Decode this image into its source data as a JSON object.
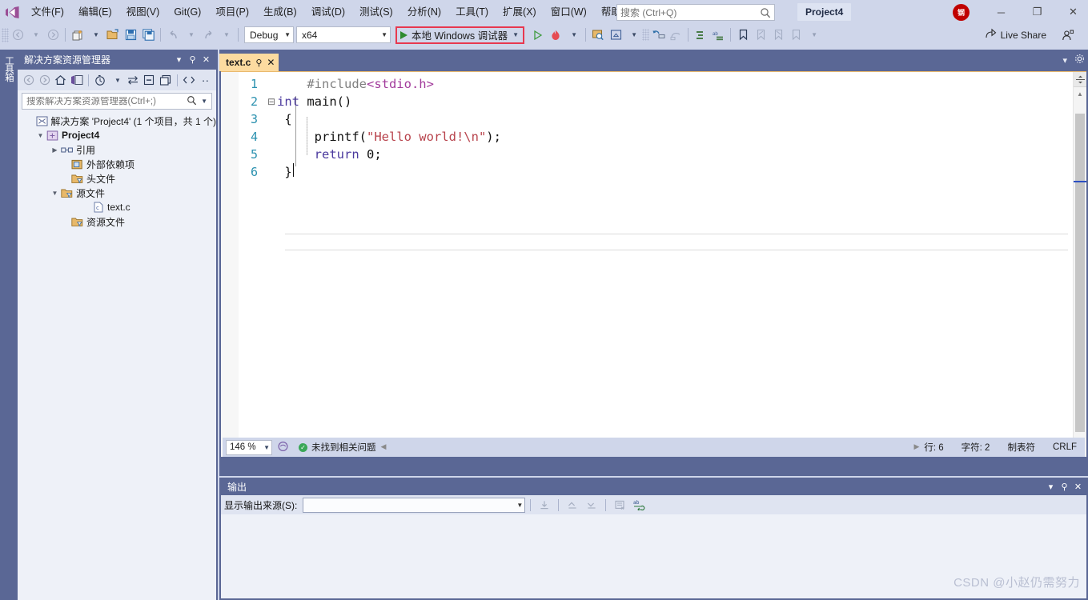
{
  "app": {
    "product": "Visual Studio",
    "project_chip": "Project4",
    "avatar_initial": "钢"
  },
  "menu": {
    "items": [
      {
        "label": "文件(F)",
        "name": "menu-file"
      },
      {
        "label": "编辑(E)",
        "name": "menu-edit"
      },
      {
        "label": "视图(V)",
        "name": "menu-view"
      },
      {
        "label": "Git(G)",
        "name": "menu-git"
      },
      {
        "label": "项目(P)",
        "name": "menu-project"
      },
      {
        "label": "生成(B)",
        "name": "menu-build"
      },
      {
        "label": "调试(D)",
        "name": "menu-debug"
      },
      {
        "label": "测试(S)",
        "name": "menu-test"
      },
      {
        "label": "分析(N)",
        "name": "menu-analyze"
      },
      {
        "label": "工具(T)",
        "name": "menu-tools"
      },
      {
        "label": "扩展(X)",
        "name": "menu-extensions"
      },
      {
        "label": "窗口(W)",
        "name": "menu-window"
      },
      {
        "label": "帮助(H)",
        "name": "menu-help"
      }
    ]
  },
  "search": {
    "placeholder": "搜索 (Ctrl+Q)",
    "value": ""
  },
  "window_controls": {
    "minimize": "─",
    "restore": "❐",
    "close": "✕"
  },
  "toolbar": {
    "configuration": "Debug",
    "platform": "x64",
    "run_label": "本地 Windows 调试器",
    "live_share": "Live Share"
  },
  "toolbox_tab": {
    "label": "工具箱"
  },
  "solution_explorer": {
    "title": "解决方案资源管理器",
    "search_placeholder": "搜索解决方案资源管理器(Ctrl+;)",
    "tree": [
      {
        "label": "解决方案 'Project4' (1 个项目，共 1 个)",
        "icon": "solution-icon",
        "indent": 0,
        "expander": "",
        "bold": false
      },
      {
        "label": "Project4",
        "icon": "project-icon",
        "indent": 1,
        "expander": "▼",
        "bold": true
      },
      {
        "label": "引用",
        "icon": "references-icon",
        "indent": 2,
        "expander": "▶",
        "bold": false
      },
      {
        "label": "外部依赖项",
        "icon": "external-deps-icon",
        "indent": 2,
        "expander": "",
        "bold": false
      },
      {
        "label": "头文件",
        "icon": "filter-folder-icon",
        "indent": 2,
        "expander": "",
        "bold": false
      },
      {
        "label": "源文件",
        "icon": "filter-folder-icon",
        "indent": 2,
        "expander": "▼",
        "bold": false
      },
      {
        "label": "text.c",
        "icon": "c-file-icon",
        "indent": 3,
        "expander": "",
        "bold": false
      },
      {
        "label": "资源文件",
        "icon": "filter-folder-icon",
        "indent": 2,
        "expander": "",
        "bold": false
      }
    ]
  },
  "editor": {
    "tab_label": "text.c",
    "lines": [
      {
        "num": "1",
        "fold": "",
        "tokens": [
          {
            "t": "    ",
            "c": "ctext"
          },
          {
            "t": "#include",
            "c": "pp"
          },
          {
            "t": "<stdio.h>",
            "c": "hdr"
          }
        ]
      },
      {
        "num": "2",
        "fold": "⊟",
        "tokens": [
          {
            "t": "int",
            "c": "kw"
          },
          {
            "t": " main()",
            "c": "ctext"
          }
        ]
      },
      {
        "num": "3",
        "fold": "",
        "tokens": [
          {
            "t": " {",
            "c": "ctext"
          }
        ]
      },
      {
        "num": "4",
        "fold": "",
        "tokens": [
          {
            "t": "     printf(",
            "c": "ctext"
          },
          {
            "t": "\"Hello world!\\n\"",
            "c": "str"
          },
          {
            "t": ");",
            "c": "ctext"
          }
        ]
      },
      {
        "num": "5",
        "fold": "",
        "tokens": [
          {
            "t": "     ",
            "c": "ctext"
          },
          {
            "t": "return",
            "c": "kw"
          },
          {
            "t": " 0;",
            "c": "ctext"
          }
        ]
      },
      {
        "num": "6",
        "fold": "",
        "tokens": [
          {
            "t": " }",
            "c": "ctext"
          }
        ]
      }
    ],
    "zoom": "146 %",
    "problems_status": "未找到相关问题",
    "status": {
      "line": "行: 6",
      "column": "字符: 2",
      "indent": "制表符",
      "eol": "CRLF"
    }
  },
  "output": {
    "title": "输出",
    "source_label": "显示输出来源(S):",
    "source_value": "",
    "body_text": ""
  },
  "watermark": "CSDN @小赵仍需努力",
  "colors": {
    "chrome": "#cfd6ea",
    "dock_header": "#5a6795",
    "accent_tab": "#fcdba0",
    "run_highlight": "#e8384f",
    "keyword": "#4b3a9e",
    "string": "#b8434c",
    "preprocessor": "#808080",
    "header_include": "#a23c9c",
    "line_number": "#2b91af",
    "avatar": "#c00000",
    "ok_green": "#3aa757"
  }
}
